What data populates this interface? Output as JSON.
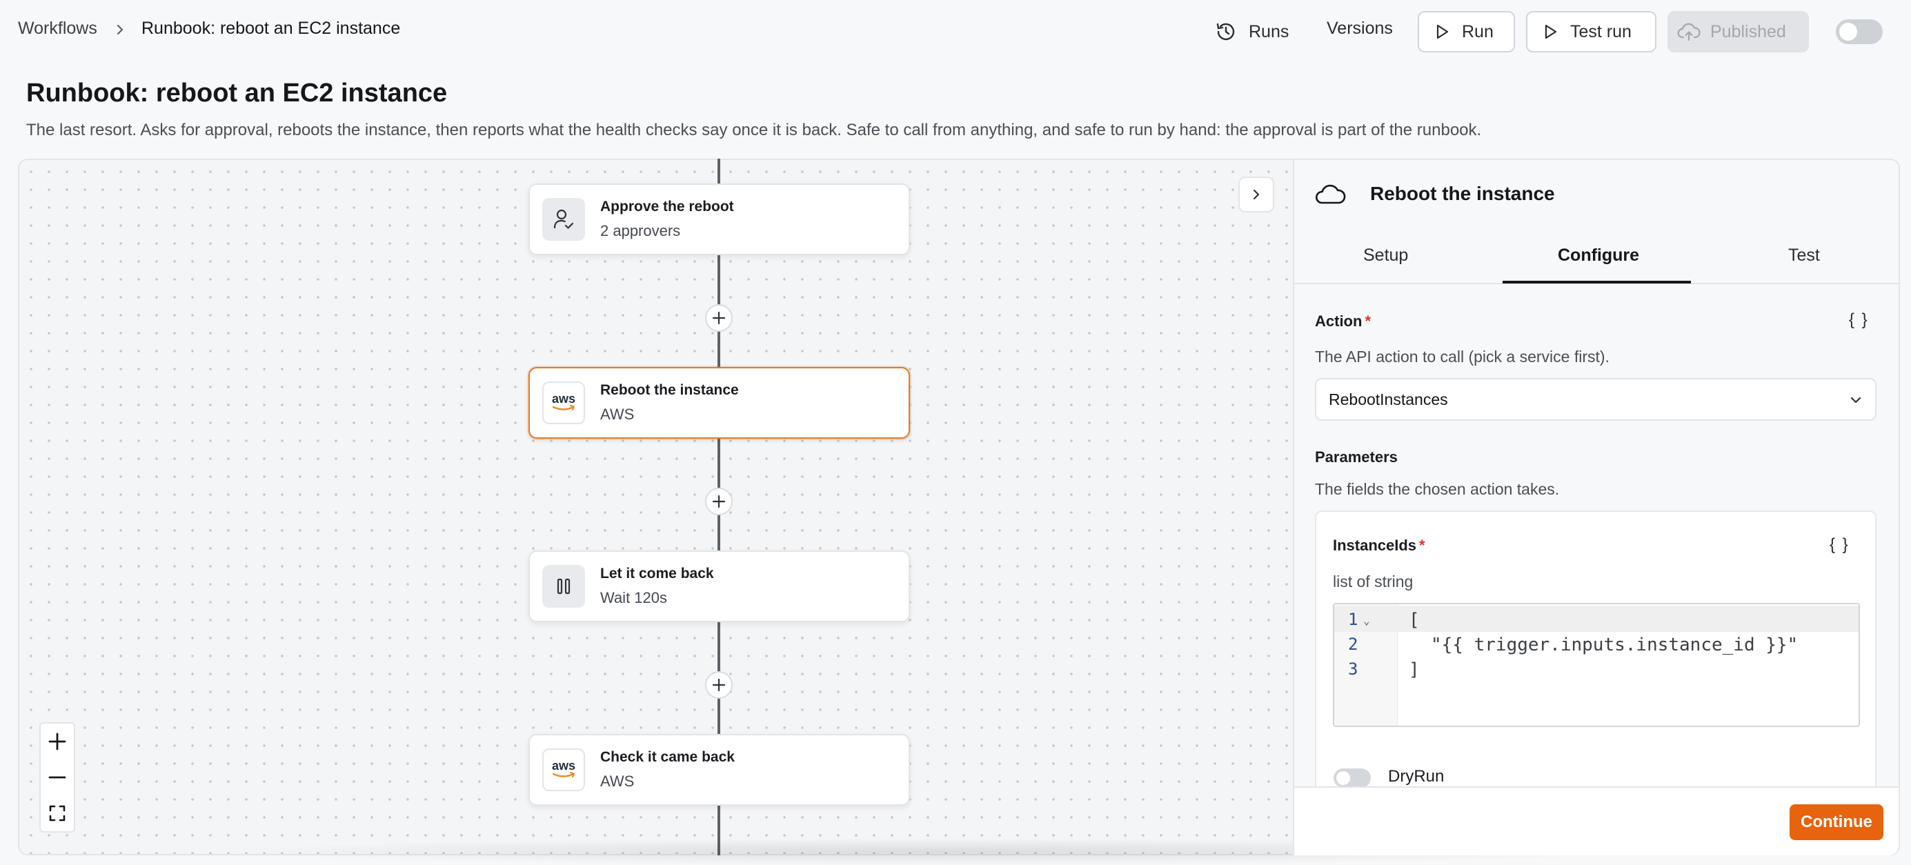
{
  "breadcrumb": {
    "root": "Workflows",
    "current": "Runbook: reboot an EC2 instance"
  },
  "toolbar": {
    "runs_label": "Runs",
    "versions_label": "Versions",
    "run_label": "Run",
    "test_run_label": "Test run",
    "published_label": "Published",
    "published_toggle_on": false
  },
  "page": {
    "title": "Runbook: reboot an EC2 instance",
    "description": "The last resort. Asks for approval, reboots the instance, then reports what the health checks say once it is back. Safe to call from anything, and safe to run by hand: the approval is part of the runbook."
  },
  "flow": {
    "nodes": [
      {
        "title": "Approve the reboot",
        "subtitle": "2 approvers",
        "icon": "user-check-icon",
        "selected": false
      },
      {
        "title": "Reboot the instance",
        "subtitle": "AWS",
        "icon": "aws-logo",
        "selected": true
      },
      {
        "title": "Let it come back",
        "subtitle": "Wait 120s",
        "icon": "pause-icon",
        "selected": false
      },
      {
        "title": "Check it came back",
        "subtitle": "AWS",
        "icon": "aws-logo",
        "selected": false
      }
    ],
    "aws_logo_text": "aws"
  },
  "panel": {
    "title": "Reboot the instance",
    "icon": "cloud-icon",
    "tabs": [
      {
        "label": "Setup",
        "active": false
      },
      {
        "label": "Configure",
        "active": true
      },
      {
        "label": "Test",
        "active": false
      }
    ],
    "action": {
      "label": "Action",
      "required_mark": "*",
      "braces": "{ }",
      "hint": "The API action to call (pick a service first).",
      "value": "RebootInstances"
    },
    "parameters": {
      "label": "Parameters",
      "hint": "The fields the chosen action takes."
    },
    "instance_ids": {
      "label": "InstanceIds",
      "required_mark": "*",
      "braces": "{ }",
      "type_hint": "list of string",
      "line_numbers": [
        "1",
        "2",
        "3"
      ],
      "fold_marker": "⌄",
      "code_lines": [
        "[",
        "\"{{ trigger.inputs.instance_id }}\"",
        "]"
      ]
    },
    "dry_run": {
      "label": "DryRun",
      "on": false
    },
    "continue_label": "Continue"
  },
  "colors": {
    "accent": "#e8630d",
    "selected_border": "#e77823",
    "required": "#e0312c",
    "code_string": "#1f7a44",
    "line_number": "#2c4e8c"
  }
}
